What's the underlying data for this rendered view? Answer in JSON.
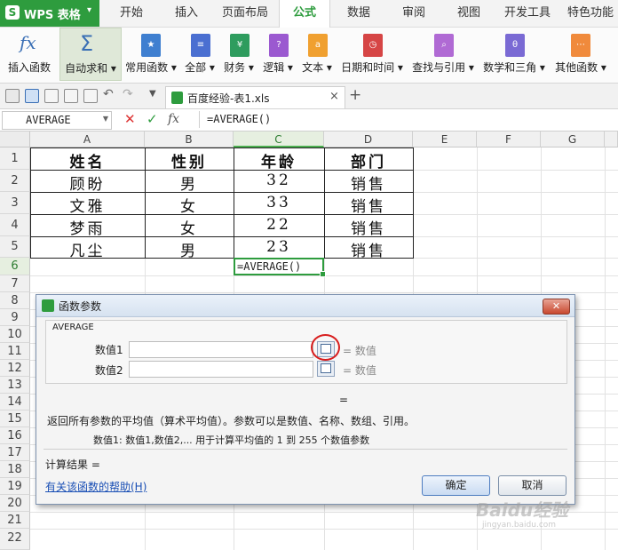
{
  "app": {
    "logo_glyph": "S",
    "name": "WPS 表格",
    "menu_caret": "▾"
  },
  "menu_tabs": [
    {
      "label": "开始"
    },
    {
      "label": "插入"
    },
    {
      "label": "页面布局"
    },
    {
      "label": "公式",
      "active": true
    },
    {
      "label": "数据"
    },
    {
      "label": "审阅"
    },
    {
      "label": "视图"
    },
    {
      "label": "开发工具"
    },
    {
      "label": "特色功能"
    }
  ],
  "ribbon": {
    "insert_function": {
      "label": "插入函数",
      "icon": "fx-icon",
      "glyph": "fx"
    },
    "autosum": {
      "label": "自动求和 ▾",
      "icon": "sigma-icon",
      "glyph": "Σ"
    },
    "groups": [
      {
        "label": "常用函数 ▾",
        "icon": "star-icon",
        "glyph": "★",
        "color": "#3f7fd0"
      },
      {
        "label": "全部 ▾",
        "icon": "list-icon",
        "glyph": "≡",
        "color": "#4a6fd1"
      },
      {
        "label": "财务 ▾",
        "icon": "finance-icon",
        "glyph": "¥",
        "color": "#2e9c5e"
      },
      {
        "label": "逻辑 ▾",
        "icon": "logic-icon",
        "glyph": "?",
        "color": "#9b59d0"
      },
      {
        "label": "文本 ▾",
        "icon": "text-icon",
        "glyph": "a",
        "color": "#f0a030"
      },
      {
        "label": "日期和时间 ▾",
        "icon": "clock-icon",
        "glyph": "◷",
        "color": "#d64545"
      },
      {
        "label": "查找与引用 ▾",
        "icon": "lookup-icon",
        "glyph": "⌕",
        "color": "#b06ad4"
      },
      {
        "label": "数学和三角 ▾",
        "icon": "math-icon",
        "glyph": "θ",
        "color": "#7a6ad4"
      },
      {
        "label": "其他函数 ▾",
        "icon": "more-functions-icon",
        "glyph": "⋯",
        "color": "#f08a3c"
      }
    ]
  },
  "quick_access": {
    "document_tab": "百度经验-表1.xls",
    "close_glyph": "×",
    "new_tab_glyph": "+"
  },
  "formula_bar": {
    "name_box": "AVERAGE",
    "cancel": "✕",
    "confirm": "✓",
    "fx": "fx",
    "formula": "=AVERAGE()"
  },
  "sheet": {
    "columns": [
      "A",
      "B",
      "C",
      "D",
      "E",
      "F",
      "G"
    ],
    "rows": [
      "1",
      "2",
      "3",
      "4",
      "5",
      "6",
      "7",
      "8",
      "9",
      "10",
      "11",
      "12",
      "13",
      "14",
      "15",
      "16",
      "17",
      "18",
      "19",
      "20",
      "21",
      "22"
    ],
    "header": [
      "姓名",
      "性别",
      "年龄",
      "部门"
    ],
    "data": [
      [
        "顾盼",
        "男",
        "32",
        "销售"
      ],
      [
        "文雅",
        "女",
        "33",
        "销售"
      ],
      [
        "梦雨",
        "女",
        "22",
        "销售"
      ],
      [
        "凡尘",
        "男",
        "23",
        "销售"
      ]
    ],
    "active_cell_value": "=AVERAGE()"
  },
  "dialog": {
    "title": "函数参数",
    "close_glyph": "✕",
    "function_name": "AVERAGE",
    "arg1_label": "数值1",
    "arg1_result": "= 数值",
    "arg2_label": "数值2",
    "arg2_result": "= 数值",
    "result_equals": "=",
    "description": "返回所有参数的平均值（算术平均值）。参数可以是数值、名称、数组、引用。",
    "arg_help": "数值1:  数值1,数值2,... 用于计算平均值的 1 到 255 个数值参数",
    "calc_result": "计算结果 =",
    "help_link": "有关该函数的帮助(H)",
    "ok": "确定",
    "cancel": "取消"
  },
  "watermark": {
    "main": "Baidu经验",
    "sub": "jingyan.baidu.com"
  }
}
